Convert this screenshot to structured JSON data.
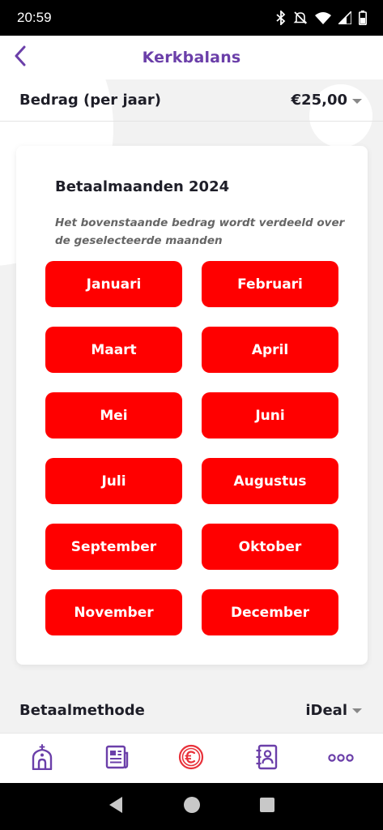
{
  "status_bar": {
    "time": "20:59",
    "icons": [
      "bluetooth-icon",
      "mute-icon",
      "wifi-icon",
      "signal-icon",
      "battery-icon"
    ]
  },
  "header": {
    "title": "Kerkbalans",
    "back_icon": "chevron-left-icon"
  },
  "amount": {
    "label": "Bedrag (per jaar)",
    "value": "€25,00"
  },
  "months_card": {
    "title": "Betaalmaanden 2024",
    "note": "Het bovenstaande bedrag wordt verdeeld over de geselecteerde maanden",
    "months": [
      "Januari",
      "Februari",
      "Maart",
      "April",
      "Mei",
      "Juni",
      "Juli",
      "Augustus",
      "September",
      "Oktober",
      "November",
      "December"
    ]
  },
  "payment_method": {
    "label": "Betaalmethode",
    "value": "iDeal"
  },
  "bottom_nav": {
    "items": [
      "church-icon",
      "news-icon",
      "euro-icon",
      "contacts-icon",
      "more-icon"
    ]
  },
  "colors": {
    "accent": "#6b3fa9",
    "month_button": "#ff0000",
    "active_nav": "#e8313a"
  }
}
